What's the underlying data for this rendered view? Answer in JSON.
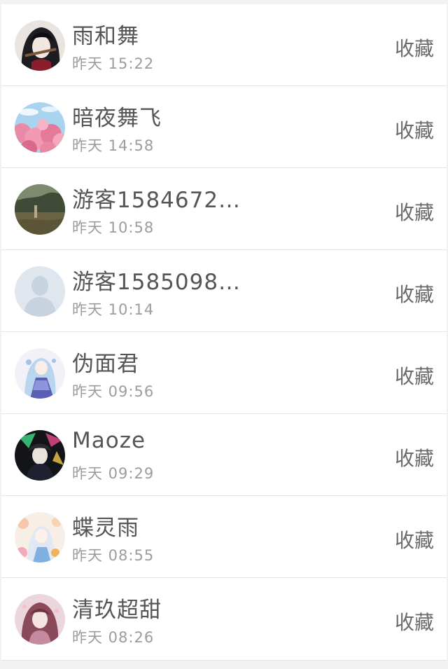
{
  "contacts": [
    {
      "name": "雨和舞",
      "time": "昨天 15:22",
      "action": "收藏",
      "avatar": "avatar-dark-hair-flute"
    },
    {
      "name": "暗夜舞飞",
      "time": "昨天 14:58",
      "action": "收藏",
      "avatar": "avatar-cherry-blossom"
    },
    {
      "name": "游客1584672…",
      "time": "昨天 10:58",
      "action": "收藏",
      "avatar": "avatar-landscape"
    },
    {
      "name": "游客1585098…",
      "time": "昨天 10:14",
      "action": "收藏",
      "avatar": "avatar-default-silhouette"
    },
    {
      "name": "伪面君",
      "time": "昨天 09:56",
      "action": "收藏",
      "avatar": "avatar-anime-blue-dress"
    },
    {
      "name": "Maoze",
      "time": "昨天 09:29",
      "action": "收藏",
      "avatar": "avatar-anime-dark-neon"
    },
    {
      "name": "蝶灵雨",
      "time": "昨天 08:55",
      "action": "收藏",
      "avatar": "avatar-anime-floral"
    },
    {
      "name": "清玖超甜",
      "time": "昨天 08:26",
      "action": "收藏",
      "avatar": "avatar-anime-pink-hair"
    }
  ],
  "colors": {
    "name_text": "#555555",
    "time_text": "#9c9c9c",
    "action_text": "#6a6a6a",
    "divider": "#e3e3e3",
    "background": "#f2f2f2"
  }
}
